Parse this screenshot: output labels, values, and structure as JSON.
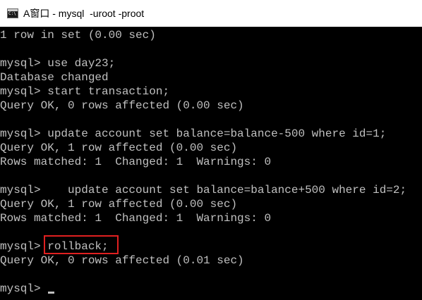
{
  "window": {
    "title": "A窗口 - mysql  -uroot -proot",
    "icon": "console-icon"
  },
  "console": {
    "lines": [
      "1 row in set (0.00 sec)",
      "",
      "mysql> use day23;",
      "Database changed",
      "mysql> start transaction;",
      "Query OK, 0 rows affected (0.00 sec)",
      "",
      "mysql> update account set balance=balance-500 where id=1;",
      "Query OK, 1 row affected (0.00 sec)",
      "Rows matched: 1  Changed: 1  Warnings: 0",
      "",
      "mysql>    update account set balance=balance+500 where id=2;",
      "Query OK, 1 row affected (0.00 sec)",
      "Rows matched: 1  Changed: 1  Warnings: 0",
      "",
      "mysql> rollback;",
      "Query OK, 0 rows affected (0.01 sec)",
      "",
      "mysql> "
    ],
    "highlight_color": "#e02020",
    "text_color": "#c0c0c0",
    "background_color": "#000000"
  }
}
